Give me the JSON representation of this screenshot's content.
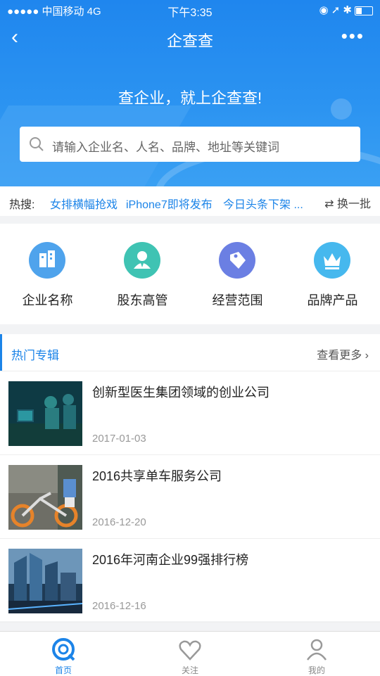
{
  "status": {
    "signal": "●●●●● 中国移动  4G",
    "time": "下午3:35",
    "right_icons": "◉ ➚ ✱"
  },
  "nav": {
    "back": "‹",
    "title": "企查查",
    "more": "•••"
  },
  "hero": {
    "slogan": "查企业，就上企查查!"
  },
  "search": {
    "placeholder": "请输入企业名、人名、品牌、地址等关键词"
  },
  "hot": {
    "label": "热搜:",
    "keywords": [
      "女排横幅抢戏",
      "iPhone7即将发布",
      "今日头条下架 ..."
    ],
    "swap": "⇄ 换一批"
  },
  "categories": [
    {
      "label": "企业名称",
      "icon": "building-icon",
      "color": "#4fa3ec"
    },
    {
      "label": "股东高管",
      "icon": "person-icon",
      "color": "#3fc3b3"
    },
    {
      "label": "经营范围",
      "icon": "tag-icon",
      "color": "#6b7fe3"
    },
    {
      "label": "品牌产品",
      "icon": "crown-icon",
      "color": "#46b8ee"
    }
  ],
  "topics": {
    "title": "热门专辑",
    "more": "查看更多 ›",
    "items": [
      {
        "title": "创新型医生集团领域的创业公司",
        "date": "2017-01-03"
      },
      {
        "title": "2016共享单车服务公司",
        "date": "2016-12-20"
      },
      {
        "title": "2016年河南企业99强排行榜",
        "date": "2016-12-16"
      }
    ]
  },
  "tabs": [
    {
      "label": "首页",
      "icon": "home-q-icon"
    },
    {
      "label": "关注",
      "icon": "follow-icon"
    },
    {
      "label": "我的",
      "icon": "profile-icon"
    }
  ],
  "colors": {
    "primary": "#1c84e8",
    "header_bg": "#1f86ee"
  }
}
